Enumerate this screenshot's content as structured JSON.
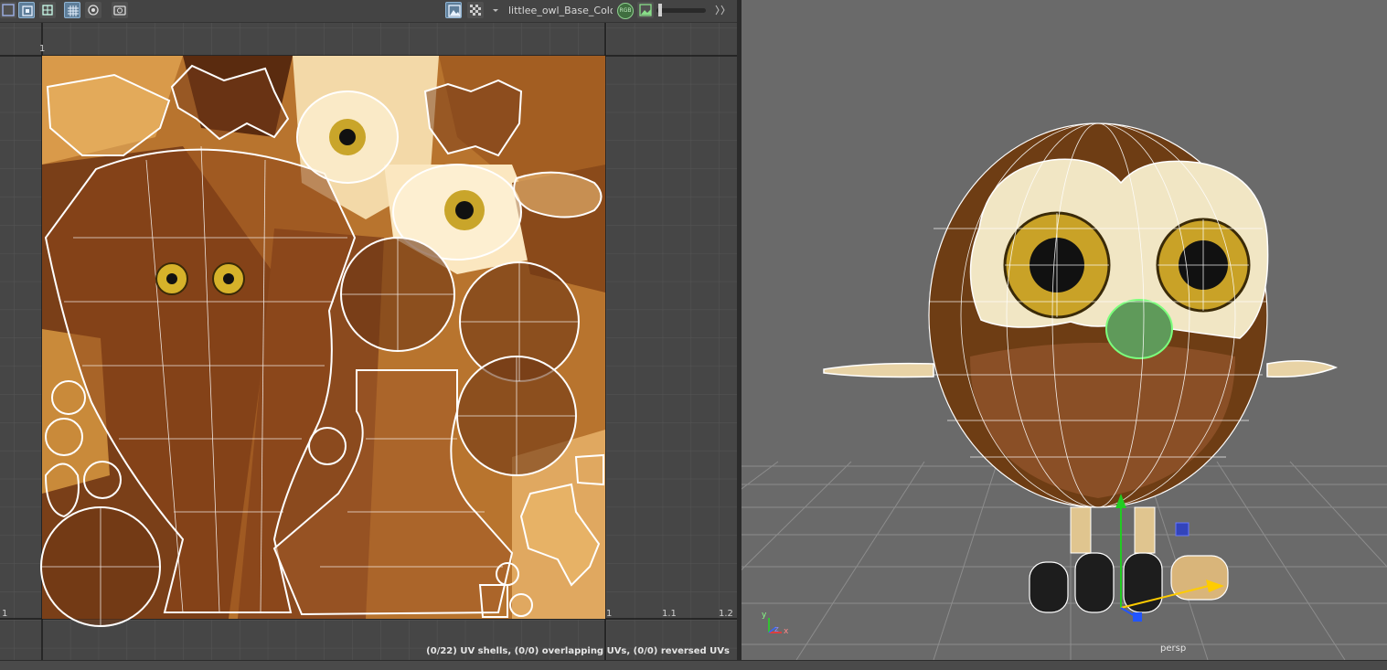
{
  "uv_editor": {
    "texture_name": "littlee_owl_Base_Colo",
    "channel_badge": "RGB",
    "axis_labels": {
      "u_top": "1",
      "u_one": "1",
      "u_one_one": "1.1",
      "u_one_two": "1.2",
      "left_mark": "1"
    },
    "status": "(0/22) UV shells, (0/0) overlapping UVs, (0/0) reversed UVs",
    "toolbar_icons": [
      "frame-icon",
      "uv-grid-icon",
      "checker-icon",
      "grid-icon",
      "snap-icon",
      "camera-icon",
      "image-icon",
      "checker-toggle-icon",
      "dropdown-arrow-icon",
      "rgb-channel-icon",
      "image-display-icon",
      "exposure-slider",
      "gamma-icon"
    ]
  },
  "viewport": {
    "camera_label": "persp",
    "axis_gizmo": {
      "x": "x",
      "y": "y",
      "z": "z"
    }
  },
  "colors": {
    "panel_bg": "#444444",
    "viewport_bg": "#686868",
    "uv_wire": "#ffffff",
    "selection": "#6aff6a",
    "manip_y": "#22cc22",
    "manip_z": "#2255ff",
    "manip_x": "#ffcc00"
  }
}
